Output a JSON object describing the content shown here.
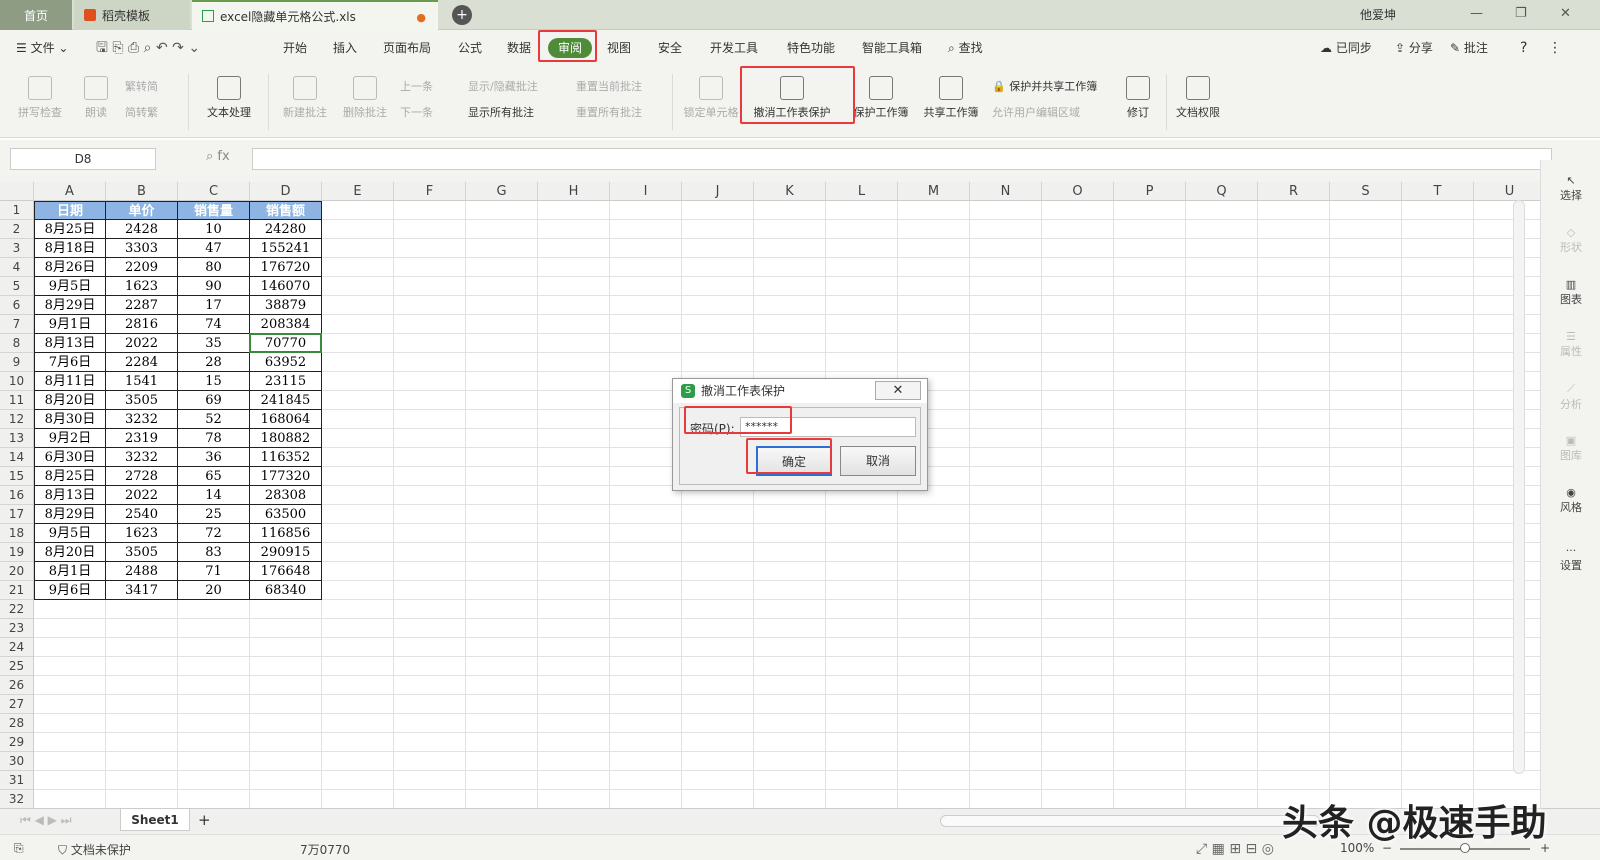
{
  "tabs": {
    "home": "首页",
    "daoke": "稻壳模板",
    "file": "excel隐藏单元格公式.xls"
  },
  "user": "他爱坤",
  "menu": {
    "file": "文件",
    "items": [
      "开始",
      "插入",
      "页面布局",
      "公式",
      "数据",
      "审阅",
      "视图",
      "安全",
      "开发工具",
      "特色功能",
      "智能工具箱"
    ],
    "search": "查找",
    "sync": "已同步",
    "share": "分享",
    "comment": "批注",
    "help": "?"
  },
  "toolbar": {
    "spell": "拼写检查",
    "read": "朗读",
    "trad": "繁转简",
    "simp": "简转繁",
    "text_proc": "文本处理",
    "new_comment": "新建批注",
    "del_comment": "删除批注",
    "prev": "上一条",
    "next": "下一条",
    "show_hide": "显示/隐藏批注",
    "show_all": "显示所有批注",
    "reset_cur": "重置当前批注",
    "reset_all": "重置所有批注",
    "lock_cell": "锁定单元格",
    "unprotect_sheet": "撤消工作表保护",
    "protect_book": "保护工作簿",
    "share_book": "共享工作簿",
    "protect_share": "保护并共享工作簿",
    "allow_edit": "允许用户编辑区域",
    "revise": "修订",
    "doc_rights": "文档权限"
  },
  "formula_bar": {
    "name_box": "D8",
    "fx": "fx",
    "content": ""
  },
  "columns": [
    "A",
    "B",
    "C",
    "D",
    "E",
    "F",
    "G",
    "H",
    "I",
    "J",
    "K",
    "L",
    "M",
    "N",
    "O",
    "P",
    "Q",
    "R",
    "S",
    "T",
    "U"
  ],
  "rows": [
    "1",
    "2",
    "3",
    "4",
    "5",
    "6",
    "7",
    "8",
    "9",
    "10",
    "11",
    "12",
    "13",
    "14",
    "15",
    "16",
    "17",
    "18",
    "19",
    "20",
    "21",
    "22",
    "23",
    "24",
    "25",
    "26",
    "27",
    "28",
    "29",
    "30",
    "31",
    "32",
    "33"
  ],
  "table": {
    "headers": [
      "日期",
      "单价",
      "销售量",
      "销售额"
    ],
    "rows": [
      [
        "8月25日",
        "2428",
        "10",
        "24280"
      ],
      [
        "8月18日",
        "3303",
        "47",
        "155241"
      ],
      [
        "8月26日",
        "2209",
        "80",
        "176720"
      ],
      [
        "9月5日",
        "1623",
        "90",
        "146070"
      ],
      [
        "8月29日",
        "2287",
        "17",
        "38879"
      ],
      [
        "9月1日",
        "2816",
        "74",
        "208384"
      ],
      [
        "8月13日",
        "2022",
        "35",
        "70770"
      ],
      [
        "7月6日",
        "2284",
        "28",
        "63952"
      ],
      [
        "8月11日",
        "1541",
        "15",
        "23115"
      ],
      [
        "8月20日",
        "3505",
        "69",
        "241845"
      ],
      [
        "8月30日",
        "3232",
        "52",
        "168064"
      ],
      [
        "9月2日",
        "2319",
        "78",
        "180882"
      ],
      [
        "6月30日",
        "3232",
        "36",
        "116352"
      ],
      [
        "8月25日",
        "2728",
        "65",
        "177320"
      ],
      [
        "8月13日",
        "2022",
        "14",
        "28308"
      ],
      [
        "8月29日",
        "2540",
        "25",
        "63500"
      ],
      [
        "9月5日",
        "1623",
        "72",
        "116856"
      ],
      [
        "8月20日",
        "3505",
        "83",
        "290915"
      ],
      [
        "8月1日",
        "2488",
        "71",
        "176648"
      ],
      [
        "9月6日",
        "3417",
        "20",
        "68340"
      ]
    ]
  },
  "right_panel": [
    "选择",
    "形状",
    "图表",
    "属性",
    "分析",
    "图库",
    "风格",
    "设置"
  ],
  "sheet": {
    "name": "Sheet1",
    "add": "+"
  },
  "status": {
    "protect": "文档未保护",
    "value": "7万0770",
    "zoom": "100%"
  },
  "dialog": {
    "title": "撤消工作表保护",
    "close": "✕",
    "label": "密码(P):",
    "password": "******",
    "ok": "确定",
    "cancel": "取消"
  },
  "watermark": "头条 @极速手助",
  "colors": {
    "accent": "#4f8c3a",
    "header_fill": "#8db4e2",
    "highlight": "#e83a3a"
  }
}
